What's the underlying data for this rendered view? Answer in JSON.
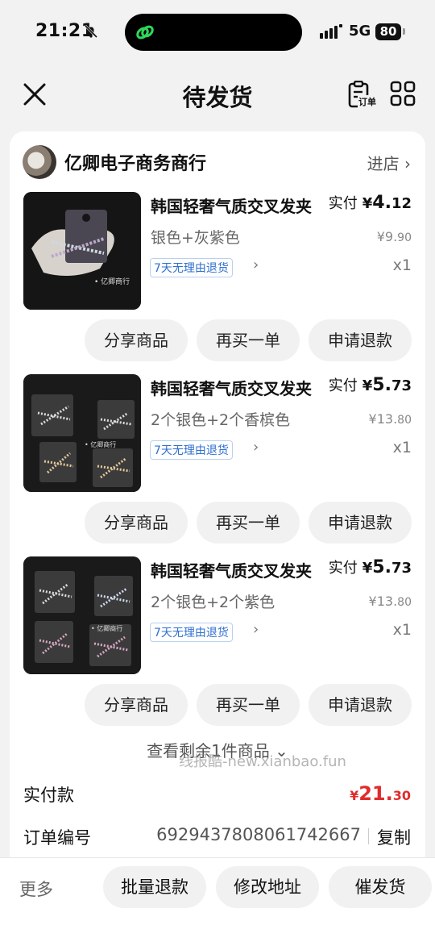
{
  "status_bar": {
    "time": "21:21",
    "network": "5G",
    "battery": "80"
  },
  "nav": {
    "title": "待发货",
    "order_icon_text": "订单"
  },
  "shop": {
    "name": "亿卿电子商务商行",
    "enter_label": "进店 ›"
  },
  "items": [
    {
      "title": "韩国轻奢气质交叉发夹",
      "variant": "银色+灰紫色",
      "paid_label": "实付",
      "paid_yen": "¥",
      "paid_int": "4.",
      "paid_dec": "12",
      "orig_int": "¥9.",
      "orig_dec": "90",
      "policy": "7天无理由退货",
      "qty": "x1",
      "img_label": "• 亿卿商行"
    },
    {
      "title": "韩国轻奢气质交叉发夹",
      "variant": "2个银色+2个香槟色",
      "paid_label": "实付",
      "paid_yen": "¥",
      "paid_int": "5.",
      "paid_dec": "73",
      "orig_int": "¥13.",
      "orig_dec": "80",
      "policy": "7天无理由退货",
      "qty": "x1",
      "img_label": "• 亿卿商行"
    },
    {
      "title": "韩国轻奢气质交叉发夹",
      "variant": "2个银色+2个紫色",
      "paid_label": "实付",
      "paid_yen": "¥",
      "paid_int": "5.",
      "paid_dec": "73",
      "orig_int": "¥13.",
      "orig_dec": "80",
      "policy": "7天无理由退货",
      "qty": "x1",
      "img_label": "• 亿卿商行"
    }
  ],
  "item_actions": {
    "share": "分享商品",
    "rebuy": "再买一单",
    "refund": "申请退款"
  },
  "more_items": "查看剩余1件商品 ⌄",
  "watermark": "线报酷-new.xianbao.fun",
  "summary": {
    "paid_label": "实付款",
    "paid_yen": "¥",
    "paid_int": "21.",
    "paid_dec": "30",
    "order_no_label": "订单编号",
    "order_no": "6929437808061742667",
    "copy_label": "复制"
  },
  "bottom_bar": {
    "more": "更多",
    "batch_refund": "批量退款",
    "edit_address": "修改地址",
    "urge": "催发货"
  },
  "colors": {
    "price_red": "#e02c2c",
    "policy_blue": "#2f6fd0"
  }
}
